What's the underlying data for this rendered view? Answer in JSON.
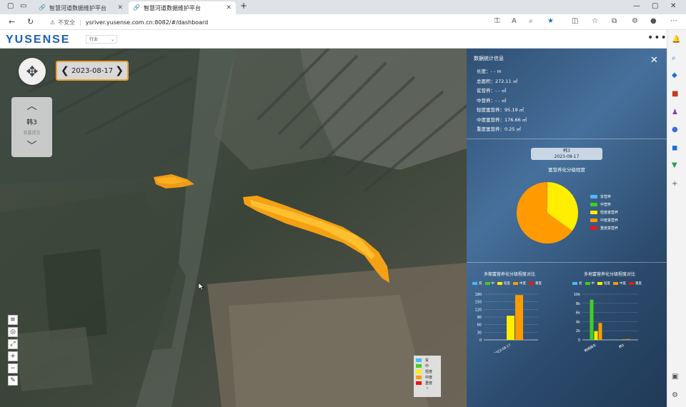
{
  "browser": {
    "tabs": [
      {
        "title": "智慧河道数据维护平台",
        "active": false
      },
      {
        "title": "智慧河道数据维护平台",
        "active": true
      }
    ],
    "security_label": "不安全",
    "url": "ysriver.yusense.com.cn:8082/#/dashboard"
  },
  "app": {
    "logo": "YUSENSE",
    "industry_select": "行业"
  },
  "map": {
    "date": "2023-08-17",
    "site": {
      "name": "韩3",
      "sub": "我要提交"
    },
    "legend": [
      {
        "label": "贫",
        "color": "#4db8ff"
      },
      {
        "label": "中",
        "color": "#40d020"
      },
      {
        "label": "轻度",
        "color": "#ffee00"
      },
      {
        "label": "中度",
        "color": "#ff9a00"
      },
      {
        "label": "重度",
        "color": "#e81818"
      }
    ]
  },
  "panel": {
    "title": "数据统计信息",
    "stats": [
      {
        "label": "长度：",
        "value": "- - m"
      },
      {
        "label": "总面积：",
        "value": "272.11 ㎡"
      },
      {
        "label": "贫营养：",
        "value": "- - ㎡"
      },
      {
        "label": "中营养：",
        "value": "- - ㎡"
      },
      {
        "label": "轻度富营养：",
        "value": "95.19 ㎡"
      },
      {
        "label": "中度富营养：",
        "value": "176.66 ㎡"
      },
      {
        "label": "重度富营养：",
        "value": "0.25 ㎡"
      }
    ],
    "site_name": "韩3",
    "site_date": "2023-08-17",
    "pie_title": "富营养化分级程度",
    "pie_legend": [
      {
        "label": "贫营养",
        "color": "#4db8ff"
      },
      {
        "label": "中营养",
        "color": "#40d020"
      },
      {
        "label": "轻度富营养",
        "color": "#ffee00"
      },
      {
        "label": "中度富营养",
        "color": "#ff9a00"
      },
      {
        "label": "重度富营养",
        "color": "#e81818"
      }
    ],
    "bar_legend": [
      "贫",
      "中",
      "轻度",
      "中度",
      "重度"
    ],
    "bar1_title": "多期富营养化分级程度对比",
    "bar2_title": "多地富营养化分级程度对比"
  },
  "chart_data": [
    {
      "type": "pie",
      "title": "富营养化分级程度",
      "categories": [
        "贫营养",
        "中营养",
        "轻度富营养",
        "中度富营养",
        "重度富营养"
      ],
      "values": [
        0,
        0,
        95.19,
        176.66,
        0.25
      ],
      "colors": [
        "#4db8ff",
        "#40d020",
        "#ffee00",
        "#ff9a00",
        "#e81818"
      ]
    },
    {
      "type": "bar",
      "title": "多期富营养化分级程度对比",
      "categories": [
        "2023-08-17"
      ],
      "series": [
        {
          "name": "贫",
          "values": [
            0
          ],
          "color": "#4db8ff"
        },
        {
          "name": "中",
          "values": [
            0
          ],
          "color": "#40d020"
        },
        {
          "name": "轻度",
          "values": [
            95.19
          ],
          "color": "#ffee00"
        },
        {
          "name": "中度",
          "values": [
            176.66
          ],
          "color": "#ff9a00"
        },
        {
          "name": "重度",
          "values": [
            0.25
          ],
          "color": "#e81818"
        }
      ],
      "ylim": [
        0,
        180
      ],
      "yticks": [
        "180",
        "150",
        "120",
        "90",
        "60",
        "30",
        "0"
      ],
      "ytick_values": [
        180,
        150,
        120,
        90,
        60,
        30,
        0
      ]
    },
    {
      "type": "bar",
      "title": "多地富营养化分级程度对比",
      "categories": [
        "韩城路东",
        "韩3"
      ],
      "series": [
        {
          "name": "贫",
          "values": [
            0,
            0
          ],
          "color": "#4db8ff"
        },
        {
          "name": "中",
          "values": [
            8800,
            0
          ],
          "color": "#40d020"
        },
        {
          "name": "轻度",
          "values": [
            1900,
            95.19
          ],
          "color": "#ffee00"
        },
        {
          "name": "中度",
          "values": [
            3700,
            176.66
          ],
          "color": "#ff9a00"
        },
        {
          "name": "重度",
          "values": [
            0,
            0.25
          ],
          "color": "#e81818"
        }
      ],
      "ylim": [
        0,
        10000
      ],
      "yticks": [
        "10k",
        "8k",
        "6k",
        "4k",
        "2k",
        "0"
      ],
      "ytick_values": [
        10000,
        8000,
        6000,
        4000,
        2000,
        0
      ]
    }
  ]
}
